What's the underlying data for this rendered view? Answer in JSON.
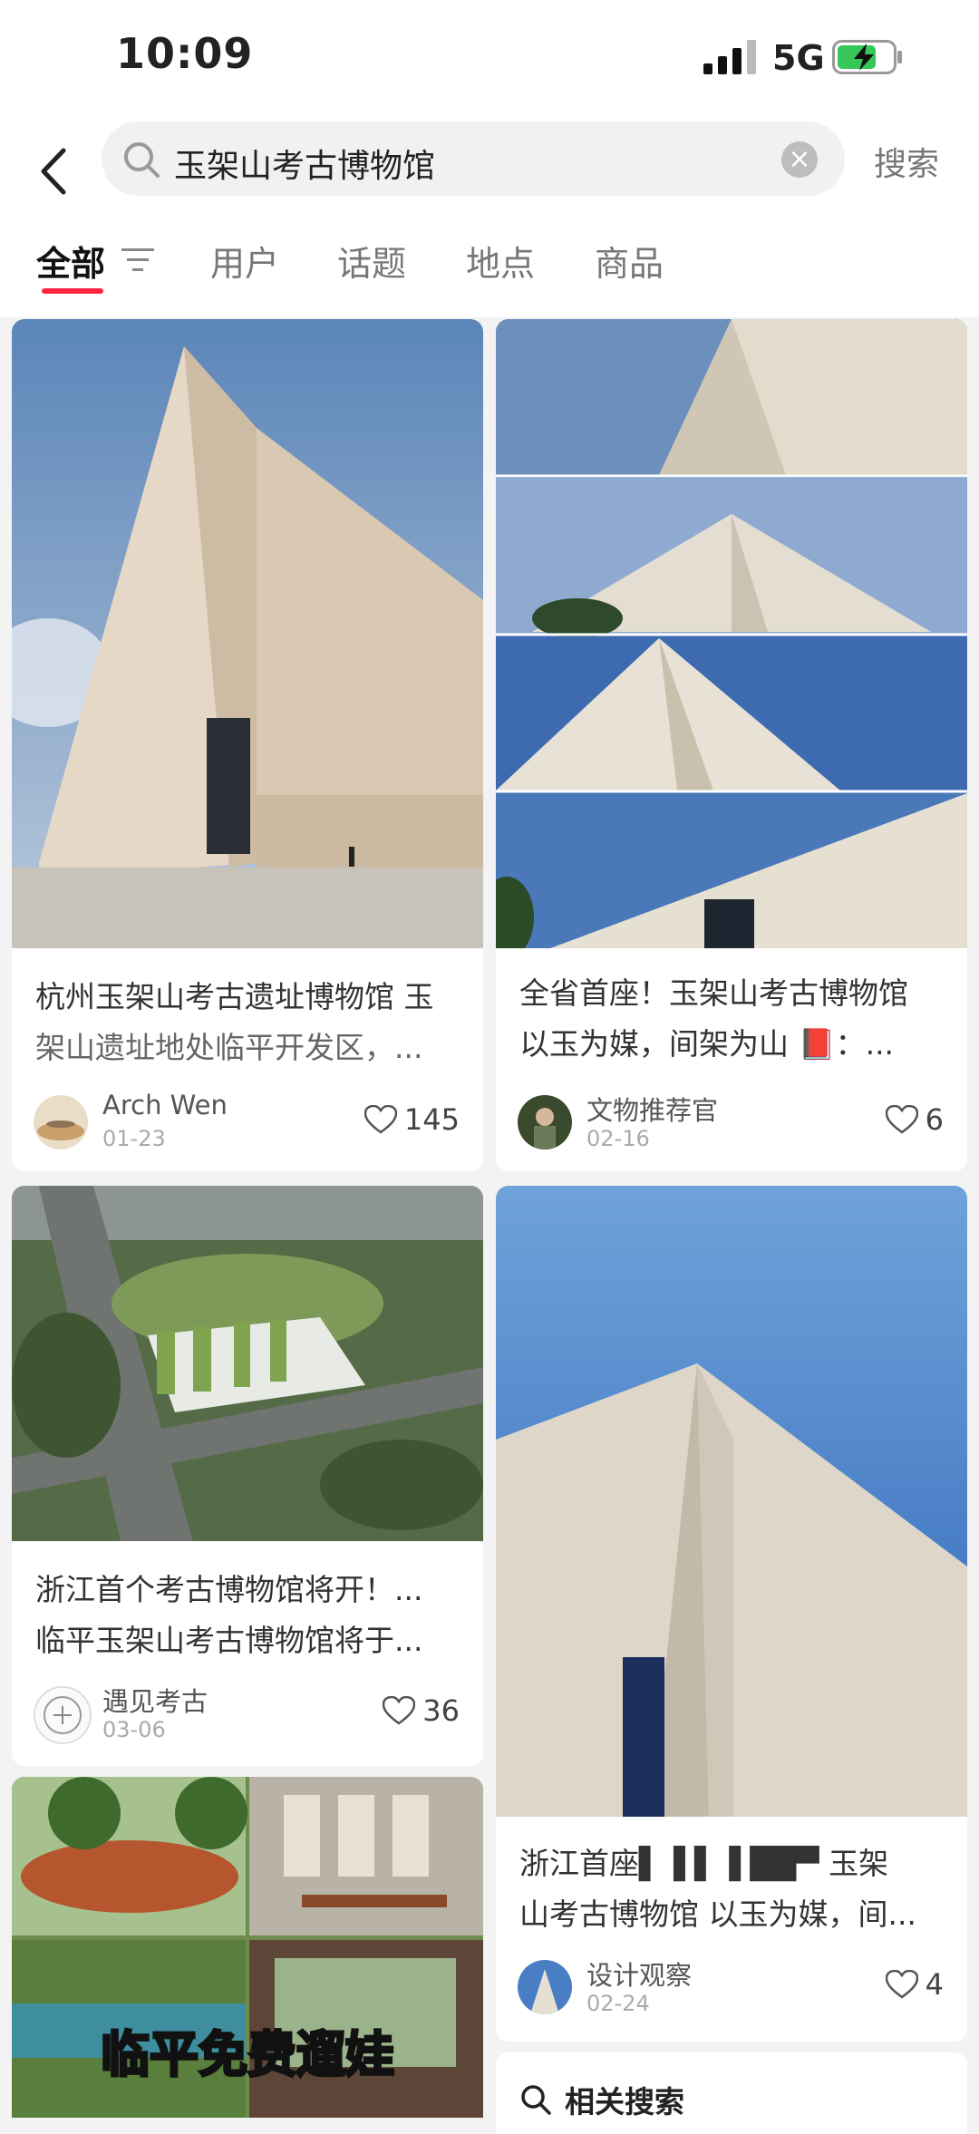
{
  "status_bar": {
    "time": "10:09",
    "network": "5G"
  },
  "search": {
    "query": "玉架山考古博物馆",
    "submit_label": "搜索"
  },
  "tabs": [
    {
      "label": "全部"
    },
    {
      "label": "用户"
    },
    {
      "label": "话题"
    },
    {
      "label": "地点"
    },
    {
      "label": "商品"
    }
  ],
  "feed": [
    {
      "title_line1": "杭州玉架山考古遗址博物馆 玉",
      "title_line2": "架山遗址地处临平开发区，...",
      "author": "Arch Wen",
      "date": "01-23",
      "likes": "145"
    },
    {
      "title_line1": "全省首座！玉架山考古博物馆",
      "title_line2": "以玉为媒，间架为山 📕：...",
      "author": "文物推荐官",
      "date": "02-16",
      "likes": "6"
    },
    {
      "title_line1": "浙江首个考古博物馆将开！...",
      "title_line2": "临平玉架山考古博物馆将于...",
      "author": "遇见考古",
      "date": "03-06",
      "likes": "36"
    },
    {
      "title_line1": "浙江首座▌▐ ▌▐ ██▀ 玉架",
      "title_line2": "山考古博物馆 以玉为媒，间...",
      "author": "设计观察",
      "date": "02-24",
      "likes": "4"
    },
    {
      "overlay_text": "临平免费遛娃"
    }
  ],
  "related": {
    "label": "相关搜索"
  },
  "colors": {
    "accent": "#ff2442",
    "battery": "#35c759"
  },
  "icons": [
    "back-arrow-icon",
    "search-icon",
    "clear-icon",
    "filter-icon",
    "heart-icon"
  ]
}
